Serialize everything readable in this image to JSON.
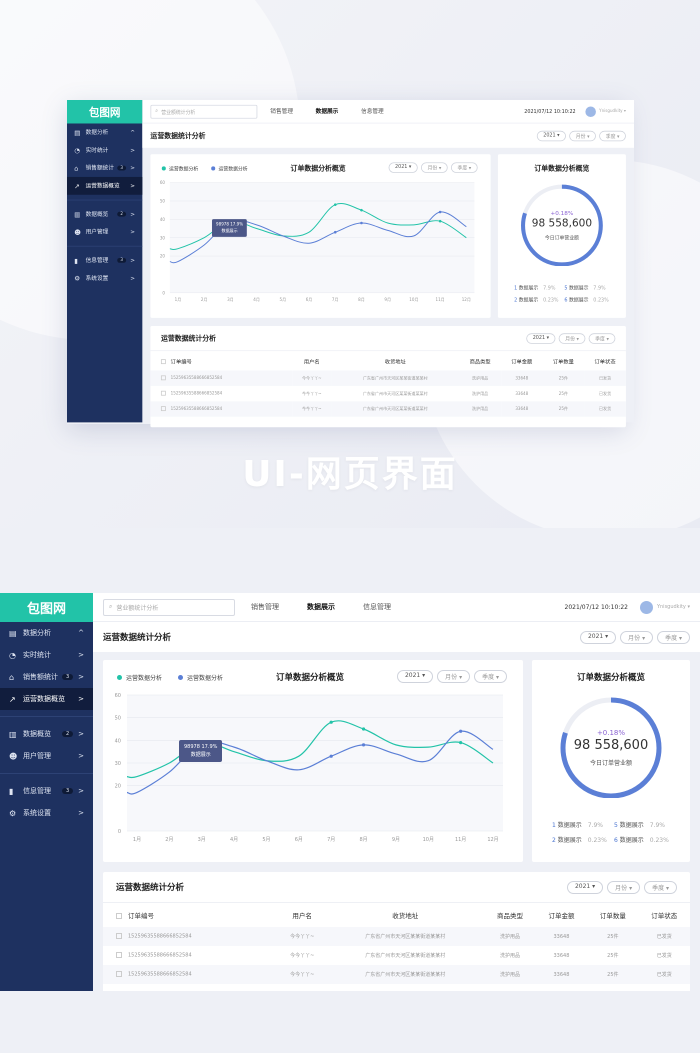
{
  "hero_title": "UI-网页界面",
  "logo": "包图网",
  "sidebar": {
    "items": [
      {
        "icon": "dashboard-icon",
        "glyph": "▤",
        "label": "数据分析",
        "arrow": "^",
        "active": false
      },
      {
        "icon": "pie-chart-icon",
        "glyph": "◔",
        "label": "实时统计",
        "arrow": ">",
        "active": false
      },
      {
        "icon": "home-icon",
        "glyph": "⌂",
        "label": "销售额统计",
        "badge": "3",
        "arrow": ">",
        "active": false
      },
      {
        "icon": "line-chart-icon",
        "glyph": "↗",
        "label": "运营数据概览",
        "arrow": ">",
        "active": true
      },
      {
        "icon": "bar-chart-icon",
        "glyph": "▥",
        "label": "数据概览",
        "badge": "2",
        "arrow": ">",
        "active": false,
        "divider": true
      },
      {
        "icon": "user-icon",
        "glyph": "☻",
        "label": "用户管理",
        "arrow": ">",
        "active": false
      },
      {
        "icon": "bar-icon",
        "glyph": "▮",
        "label": "信息管理",
        "badge": "3",
        "arrow": ">",
        "active": false,
        "divider": true
      },
      {
        "icon": "gear-icon",
        "glyph": "⚙",
        "label": "系统设置",
        "arrow": ">",
        "active": false
      }
    ]
  },
  "header": {
    "search_placeholder": "营业额统计分析",
    "nav": [
      "销售管理",
      "数据展示",
      "信息管理"
    ],
    "active_nav": 1,
    "time": "2021/07/12 10:10:22",
    "user": "Ynisgudkity ▾"
  },
  "page_title": "运营数据统计分析",
  "filters": [
    "2021 ▾",
    "月份 ▾",
    "季度 ▾"
  ],
  "chart_card": {
    "legend": [
      "运营数据分析",
      "运营数据分析"
    ],
    "title": "订单数据分析概览",
    "tooltip": {
      "value": "98978  17.9%",
      "label": "数据展示"
    }
  },
  "colors": {
    "teal": "#22c3a8",
    "blue": "#5b7fd6",
    "sidebar": "#1e3160"
  },
  "chart_data": {
    "type": "line",
    "categories": [
      "1月",
      "2月",
      "3月",
      "4月",
      "5月",
      "6月",
      "7月",
      "8月",
      "9月",
      "10月",
      "11月",
      "12月"
    ],
    "yticks": [
      0,
      20,
      30,
      40,
      50,
      60
    ],
    "ylim": [
      0,
      60
    ],
    "grid": true,
    "series": [
      {
        "name": "运营数据分析",
        "color": "#22c3a8",
        "values": [
          24,
          30,
          39,
          35,
          31,
          33,
          48,
          45,
          38,
          37,
          39,
          30
        ]
      },
      {
        "name": "运营数据分析",
        "color": "#5b7fd6",
        "values": [
          17,
          26,
          39,
          37,
          31,
          27,
          33,
          38,
          34,
          31,
          44,
          36
        ]
      }
    ]
  },
  "summary": {
    "title": "订单数据分析概览",
    "change": "+0.18%",
    "amount": "98 558,600",
    "label": "今日订单营业额",
    "progress": 0.8,
    "stats": [
      {
        "n": "1",
        "label": "数据展示",
        "v": "7.9%"
      },
      {
        "n": "5",
        "label": "数据展示",
        "v": "7.9%"
      },
      {
        "n": "2",
        "label": "数据展示",
        "v": "0.23%"
      },
      {
        "n": "6",
        "label": "数据展示",
        "v": "0.23%"
      }
    ]
  },
  "table": {
    "title": "运营数据统计分析",
    "columns": [
      "订单编号",
      "用户名",
      "收货地址",
      "商品类型",
      "订单金额",
      "订单数量",
      "订单状态"
    ],
    "rows": [
      [
        "15259635588666852584",
        "今今丫丫~",
        "广东省广州市天河区某某街道某某村",
        "洗护用品",
        "33648",
        "25件",
        "已发货"
      ],
      [
        "15259635588666852584",
        "今今丫丫~",
        "广东省广州市天河区某某街道某某村",
        "洗护用品",
        "33648",
        "25件",
        "已发货"
      ],
      [
        "15259635588666852584",
        "今今丫丫~",
        "广东省广州市天河区某某街道某某村",
        "洗护用品",
        "33648",
        "25件",
        "已发货"
      ]
    ]
  }
}
